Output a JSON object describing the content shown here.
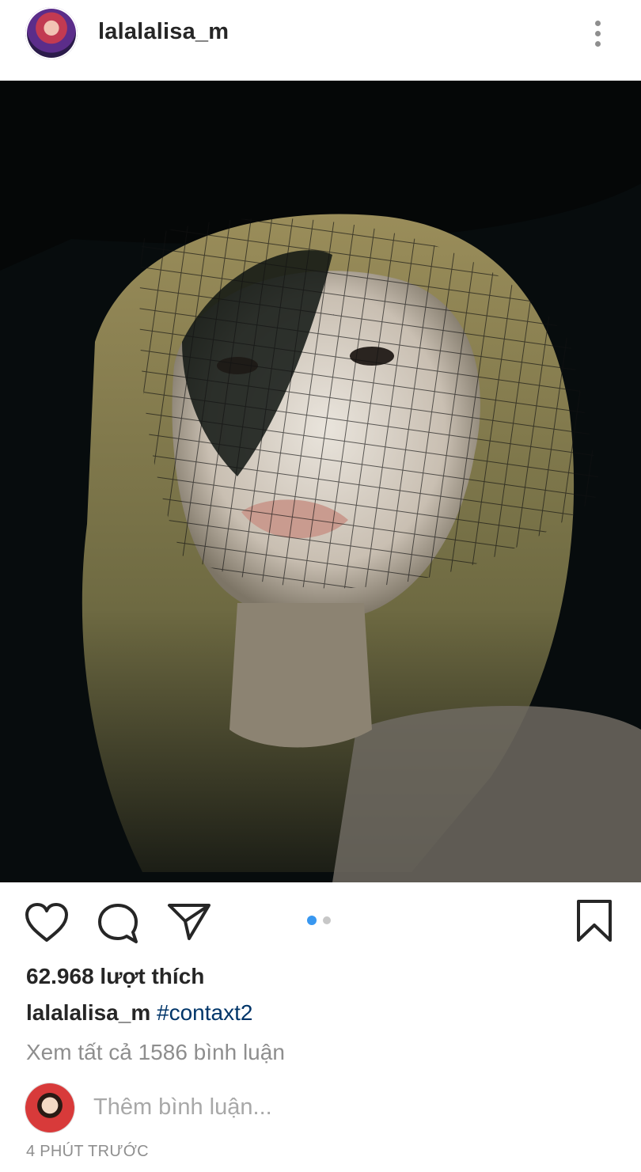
{
  "header": {
    "username": "lalalalisa_m",
    "avatar_icon": "profile-avatar",
    "more_icon": "more-vertical-icon"
  },
  "post": {
    "image_description_icon": "post-photo",
    "carousel": {
      "total": 2,
      "active_index": 0,
      "active_color": "#3897f0",
      "inactive_color": "#c7c7c7"
    }
  },
  "actions": {
    "like_icon": "heart-icon",
    "comment_icon": "comment-icon",
    "share_icon": "send-icon",
    "save_icon": "bookmark-icon"
  },
  "likes": {
    "text": "62.968 lượt thích"
  },
  "caption": {
    "username": "lalalalisa_m",
    "hashtag": "#contaxt2"
  },
  "comments": {
    "view_all": "Xem tất cả 1586 bình luận"
  },
  "comment_box": {
    "placeholder": "Thêm bình luận..."
  },
  "timestamp": "4 PHÚT TRƯỚC",
  "colors": {
    "text": "#262626",
    "muted": "#8e8e8e",
    "hashtag": "#003569",
    "accent": "#3897f0"
  }
}
